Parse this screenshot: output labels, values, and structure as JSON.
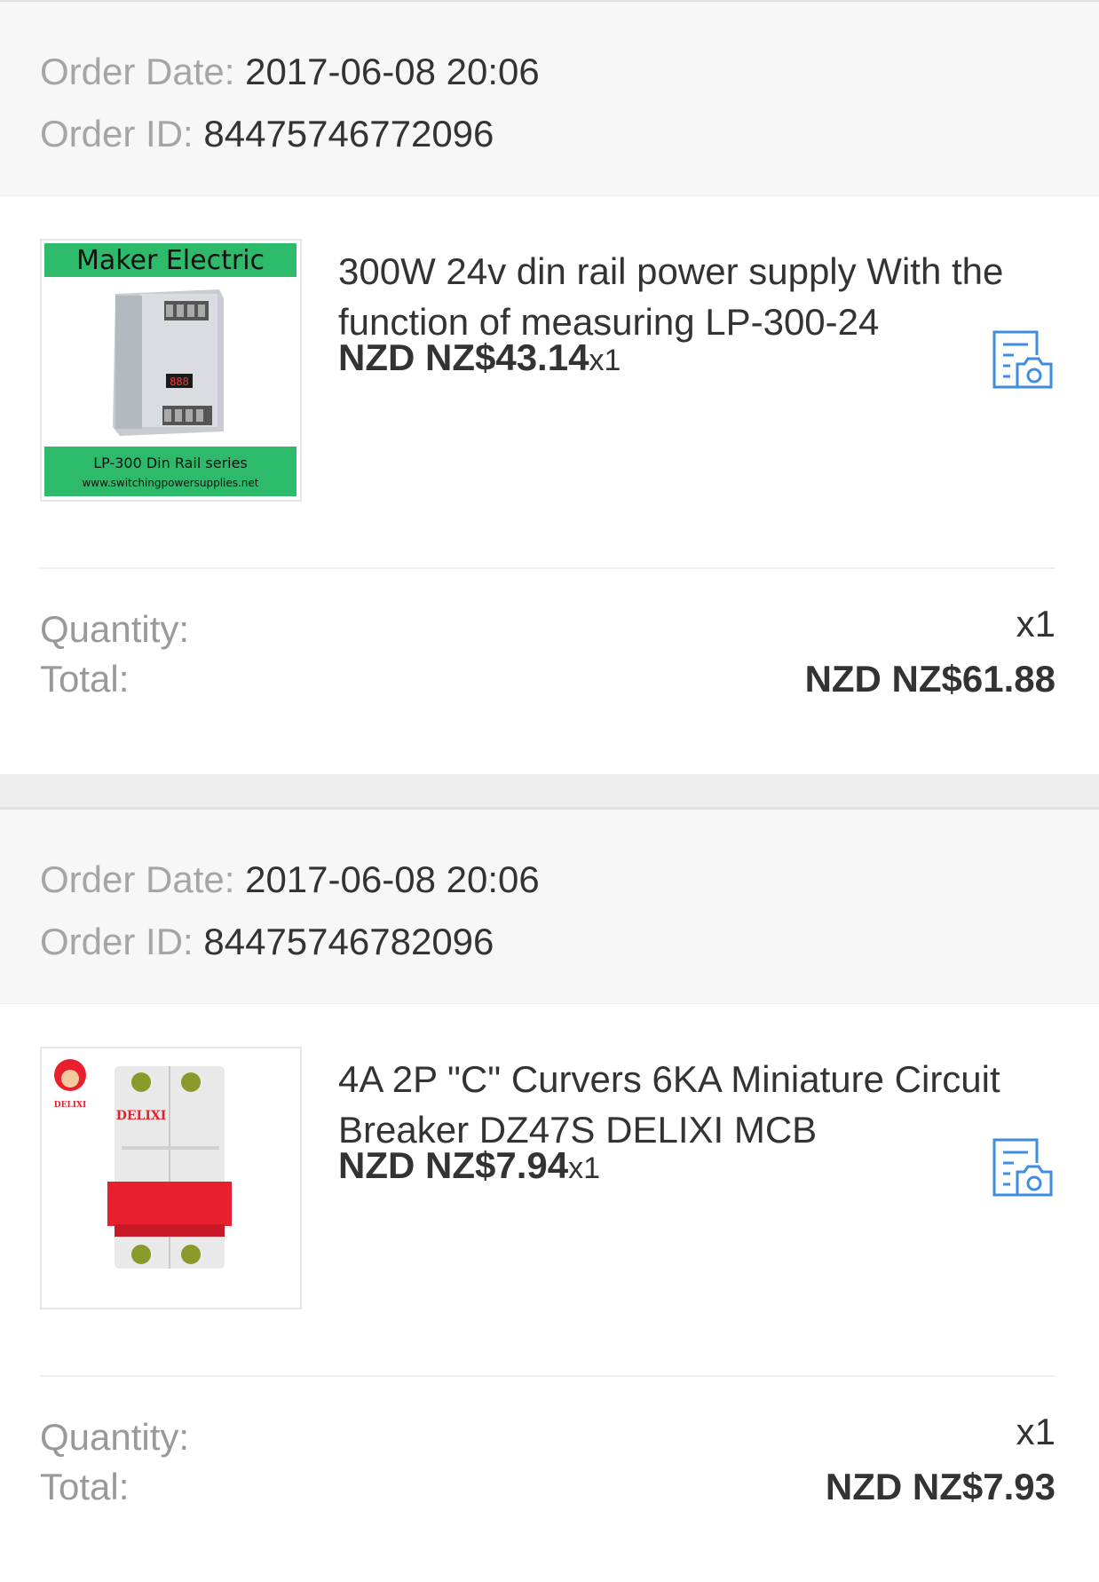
{
  "orders": [
    {
      "header": {
        "date_label": "Order Date:",
        "date": "2017-06-08 20:06",
        "id_label": "Order ID:",
        "id": "84475746772096"
      },
      "product": {
        "title": "300W 24v din rail  power supply With the function of measuring LP-300-24",
        "price": "NZD NZ$43.14",
        "qty": "x1",
        "image_brand": "Maker Electric",
        "image_caption": "LP-300 Din Rail series",
        "image_url_text": "www.switchingpowersupplies.net",
        "snapshot_icon": "snapshot-icon"
      },
      "summary": {
        "quantity_label": "Quantity:",
        "quantity": "x1",
        "total_label": "Total:",
        "total": "NZD NZ$61.88"
      }
    },
    {
      "header": {
        "date_label": "Order Date:",
        "date": "2017-06-08 20:06",
        "id_label": "Order ID:",
        "id": "84475746782096"
      },
      "product": {
        "title": "4A 2P  \"C\" Curvers 6KA Miniature Circuit Breaker DZ47S DELIXI MCB",
        "price": "NZD NZ$7.94",
        "qty": "x1",
        "image_brand": "DELIXI",
        "snapshot_icon": "snapshot-icon"
      },
      "summary": {
        "quantity_label": "Quantity:",
        "quantity": "x1",
        "total_label": "Total:",
        "total": "NZD NZ$7.93"
      }
    }
  ],
  "colors": {
    "label_gray": "#a5a5a5",
    "text_dark": "#333333",
    "icon_blue": "#3d8ee0",
    "green_banner": "#2dba6a",
    "breaker_red": "#e8202e"
  }
}
